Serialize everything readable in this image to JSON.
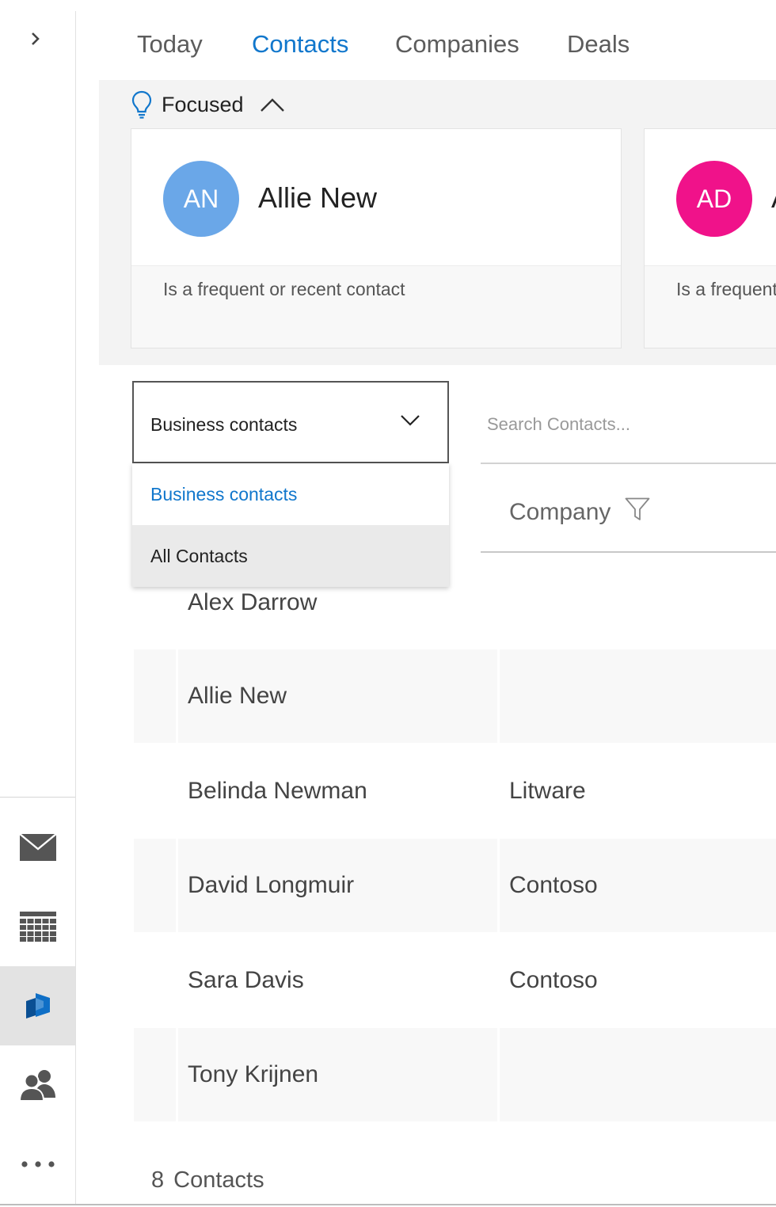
{
  "nav": {
    "tabs": [
      {
        "label": "Today"
      },
      {
        "label": "Contacts"
      },
      {
        "label": "Companies"
      },
      {
        "label": "Deals"
      }
    ]
  },
  "focused": {
    "label": "Focused",
    "cards": [
      {
        "initials": "AN",
        "name": "Allie New",
        "reason": "Is a frequent or recent contact",
        "color": "#6aa7e8"
      },
      {
        "initials": "AD",
        "name": "A",
        "reason": "Is a frequent",
        "color": "#f0128a"
      }
    ]
  },
  "filter": {
    "selected": "Business contacts",
    "options": [
      "Business contacts",
      "All Contacts"
    ]
  },
  "search": {
    "placeholder": "Search Contacts..."
  },
  "table": {
    "company_header": "Company",
    "rows": [
      {
        "name": "Alex Darrow",
        "company": ""
      },
      {
        "name": "Allie New",
        "company": ""
      },
      {
        "name": "Belinda Newman",
        "company": "Litware"
      },
      {
        "name": "David Longmuir",
        "company": "Contoso"
      },
      {
        "name": "Sara Davis",
        "company": "Contoso"
      },
      {
        "name": "Tony Krijnen",
        "company": ""
      }
    ]
  },
  "footer": {
    "count": "8",
    "count_label": "Contacts"
  },
  "colors": {
    "accent": "#1177cc",
    "icon_blue": "#0f6fc6",
    "icon_gray": "#555555"
  }
}
